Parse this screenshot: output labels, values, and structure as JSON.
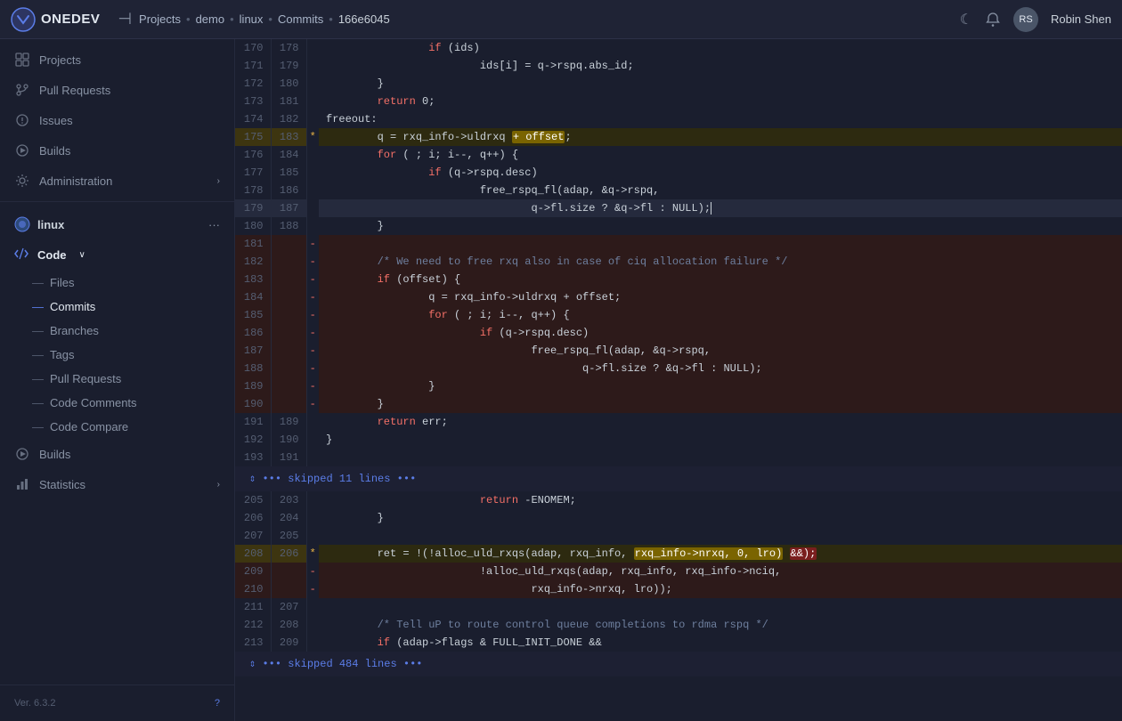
{
  "topnav": {
    "logo_text": "ONEDEV",
    "breadcrumb": [
      "Projects",
      "demo",
      "linux",
      "Commits",
      "166e6045"
    ],
    "user_name": "Robin Shen"
  },
  "sidebar": {
    "global_items": [
      {
        "label": "Projects",
        "icon": "grid-icon"
      },
      {
        "label": "Pull Requests",
        "icon": "git-pr-icon"
      },
      {
        "label": "Issues",
        "icon": "issue-icon"
      },
      {
        "label": "Builds",
        "icon": "builds-icon"
      },
      {
        "label": "Administration",
        "icon": "admin-icon",
        "has_chevron": true
      }
    ],
    "project_name": "linux",
    "code_label": "Code",
    "code_items": [
      {
        "label": "Files"
      },
      {
        "label": "Commits",
        "active": true
      },
      {
        "label": "Branches"
      },
      {
        "label": "Tags"
      },
      {
        "label": "Pull Requests"
      },
      {
        "label": "Code Comments"
      },
      {
        "label": "Code Compare"
      }
    ],
    "bottom_items": [
      {
        "label": "Builds",
        "icon": "builds-icon"
      },
      {
        "label": "Statistics",
        "icon": "stats-icon",
        "has_chevron": true
      }
    ],
    "ver": "Ver. 6.3.2"
  },
  "diff": {
    "lines": []
  }
}
